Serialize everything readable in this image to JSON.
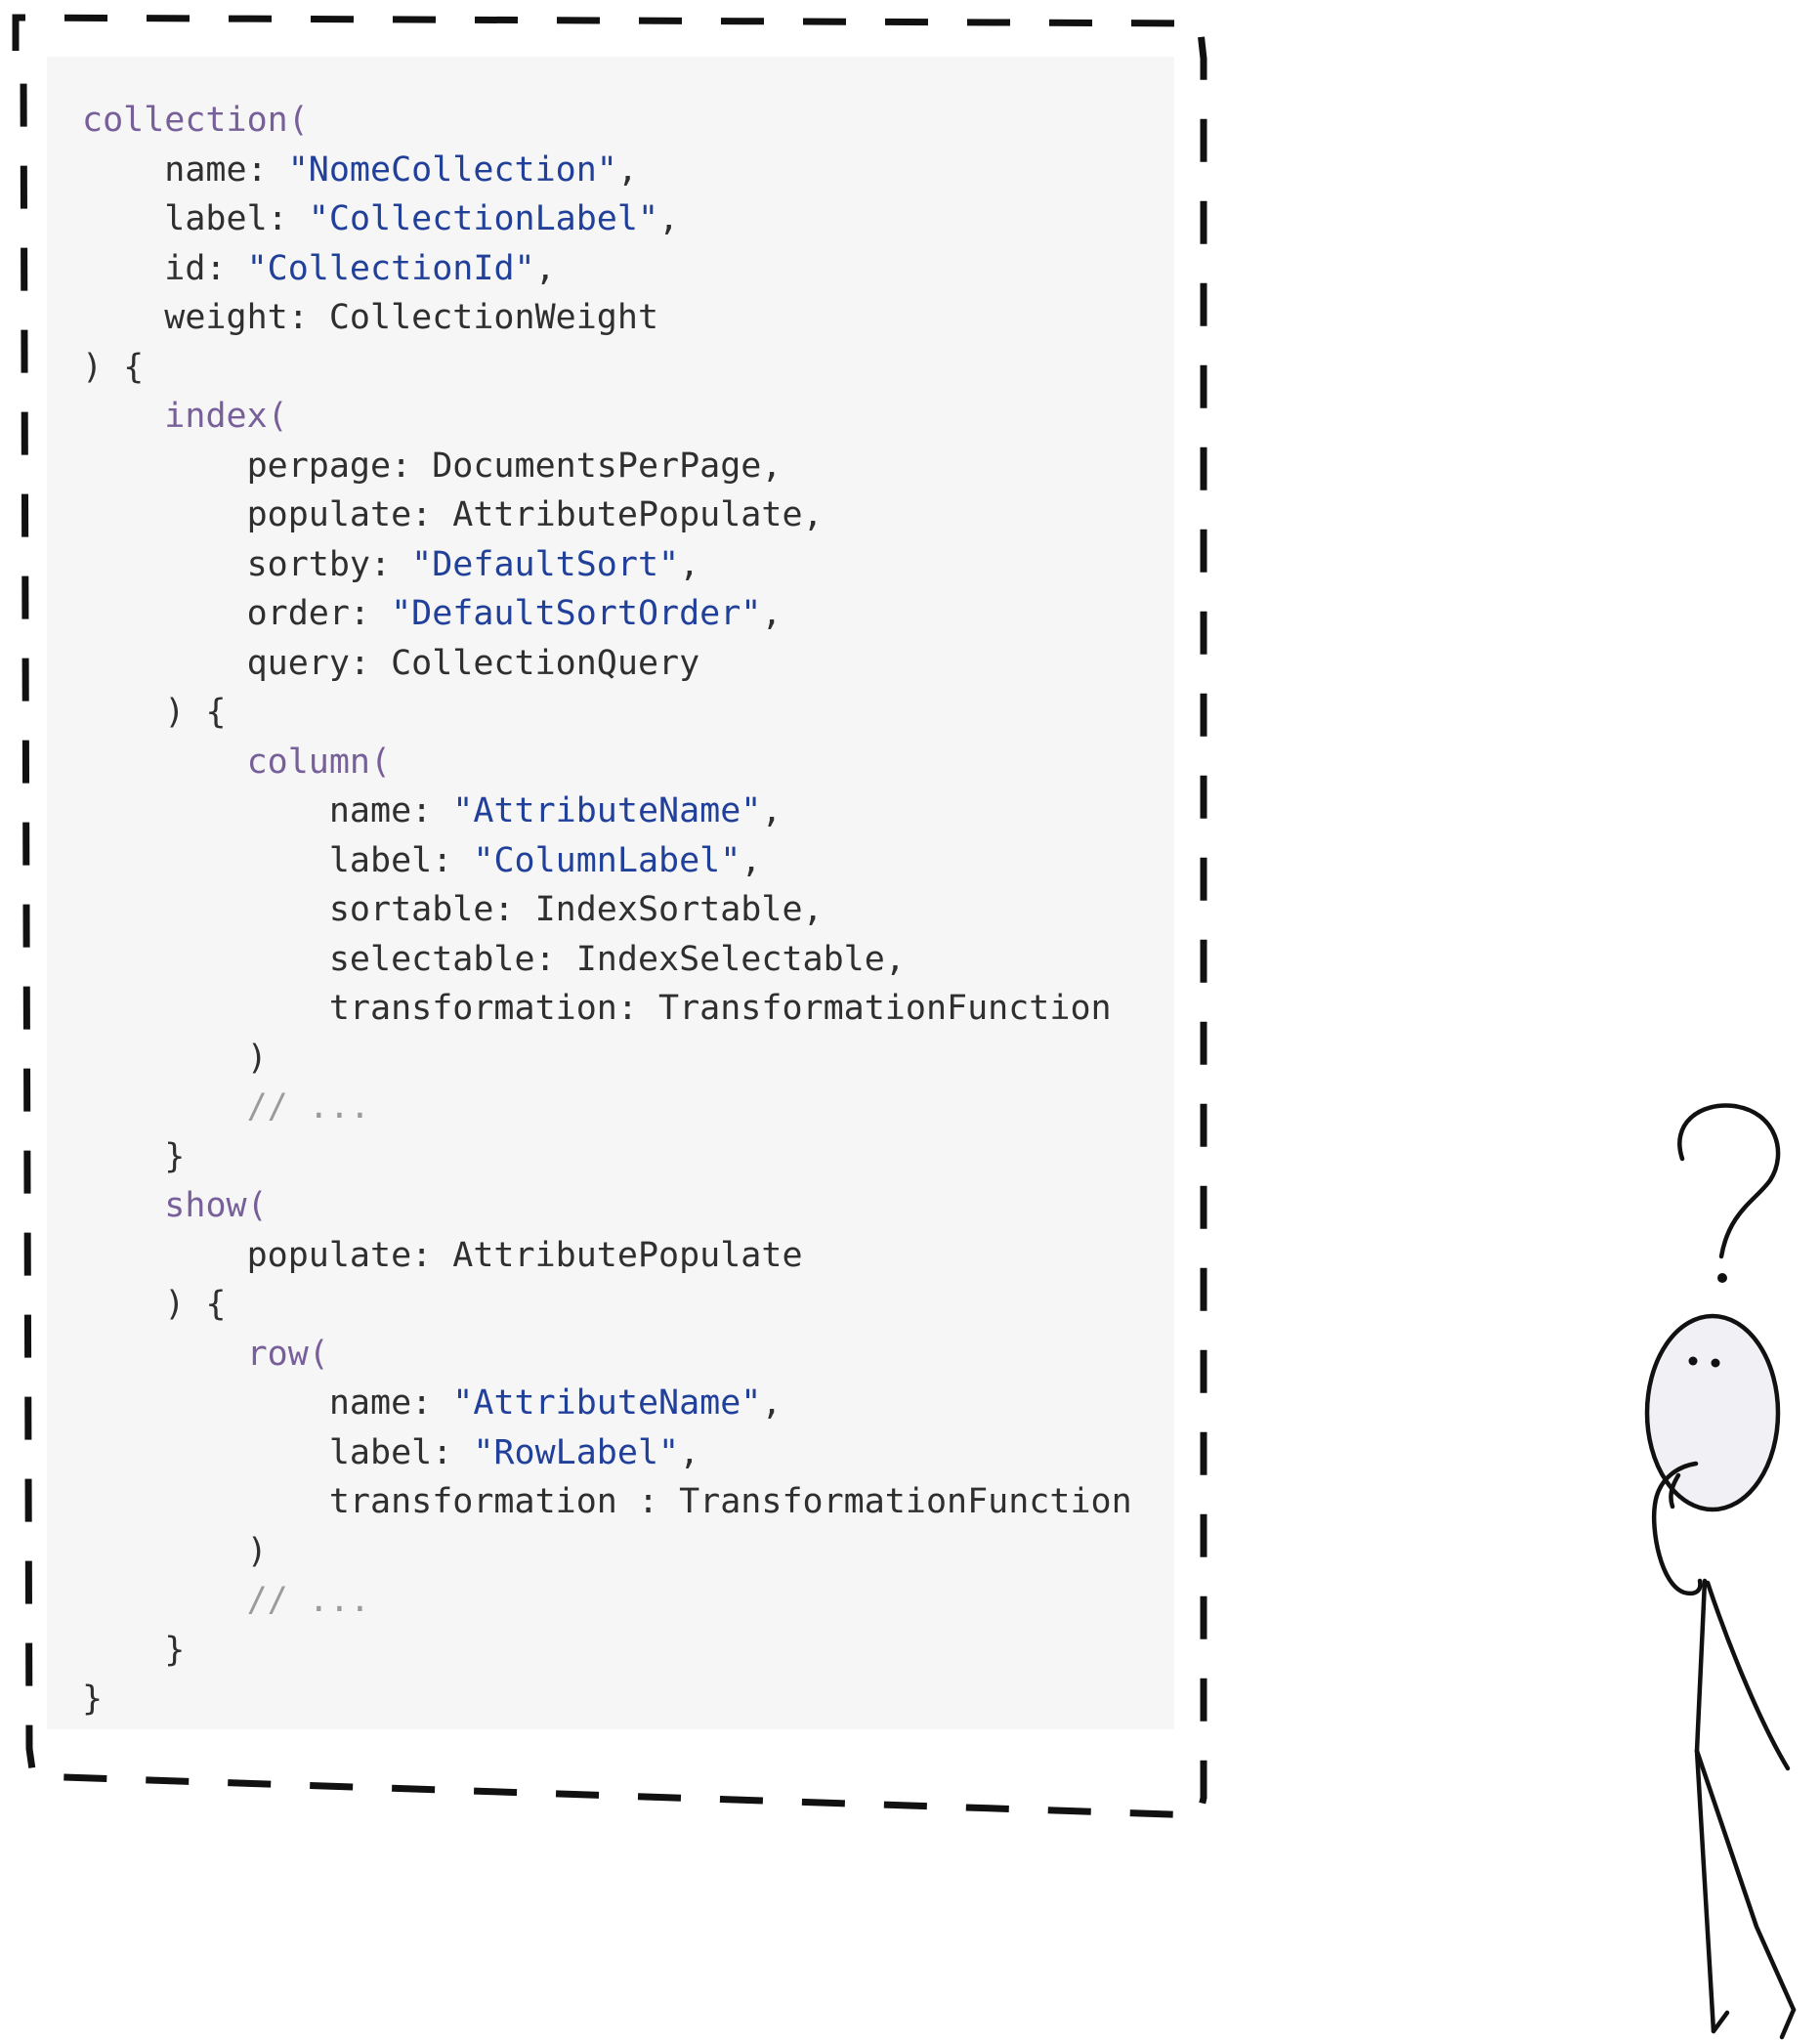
{
  "code_lines": [
    [
      {
        "t": "collection(",
        "c": "fn"
      }
    ],
    [
      {
        "t": "    name: ",
        "c": "pl"
      },
      {
        "t": "\"NomeCollection\"",
        "c": "str"
      },
      {
        "t": ",",
        "c": "pl"
      }
    ],
    [
      {
        "t": "    label: ",
        "c": "pl"
      },
      {
        "t": "\"CollectionLabel\"",
        "c": "str"
      },
      {
        "t": ",",
        "c": "pl"
      }
    ],
    [
      {
        "t": "    id: ",
        "c": "pl"
      },
      {
        "t": "\"CollectionId\"",
        "c": "str"
      },
      {
        "t": ",",
        "c": "pl"
      }
    ],
    [
      {
        "t": "    weight: CollectionWeight",
        "c": "pl"
      }
    ],
    [
      {
        "t": ") {",
        "c": "pl"
      }
    ],
    [
      {
        "t": "    ",
        "c": "pl"
      },
      {
        "t": "index(",
        "c": "fn"
      }
    ],
    [
      {
        "t": "        perpage: DocumentsPerPage,",
        "c": "pl"
      }
    ],
    [
      {
        "t": "        populate: AttributePopulate,",
        "c": "pl"
      }
    ],
    [
      {
        "t": "        sortby: ",
        "c": "pl"
      },
      {
        "t": "\"DefaultSort\"",
        "c": "str"
      },
      {
        "t": ",",
        "c": "pl"
      }
    ],
    [
      {
        "t": "        order: ",
        "c": "pl"
      },
      {
        "t": "\"DefaultSortOrder\"",
        "c": "str"
      },
      {
        "t": ",",
        "c": "pl"
      }
    ],
    [
      {
        "t": "        query: CollectionQuery",
        "c": "pl"
      }
    ],
    [
      {
        "t": "    ) {",
        "c": "pl"
      }
    ],
    [
      {
        "t": "        ",
        "c": "pl"
      },
      {
        "t": "column(",
        "c": "fn"
      }
    ],
    [
      {
        "t": "            name: ",
        "c": "pl"
      },
      {
        "t": "\"AttributeName\"",
        "c": "str"
      },
      {
        "t": ",",
        "c": "pl"
      }
    ],
    [
      {
        "t": "            label: ",
        "c": "pl"
      },
      {
        "t": "\"ColumnLabel\"",
        "c": "str"
      },
      {
        "t": ",",
        "c": "pl"
      }
    ],
    [
      {
        "t": "            sortable: IndexSortable,",
        "c": "pl"
      }
    ],
    [
      {
        "t": "            selectable: IndexSelectable,",
        "c": "pl"
      }
    ],
    [
      {
        "t": "            transformation: TransformationFunction",
        "c": "pl"
      }
    ],
    [
      {
        "t": "        )",
        "c": "pl"
      }
    ],
    [
      {
        "t": "        // ...",
        "c": "cm"
      }
    ],
    [
      {
        "t": "    }",
        "c": "pl"
      }
    ],
    [
      {
        "t": "    ",
        "c": "pl"
      },
      {
        "t": "show(",
        "c": "fn"
      }
    ],
    [
      {
        "t": "        populate: AttributePopulate",
        "c": "pl"
      }
    ],
    [
      {
        "t": "    ) {",
        "c": "pl"
      }
    ],
    [
      {
        "t": "        ",
        "c": "pl"
      },
      {
        "t": "row(",
        "c": "fn"
      }
    ],
    [
      {
        "t": "            name: ",
        "c": "pl"
      },
      {
        "t": "\"AttributeName\"",
        "c": "str"
      },
      {
        "t": ",",
        "c": "pl"
      }
    ],
    [
      {
        "t": "            label: ",
        "c": "pl"
      },
      {
        "t": "\"RowLabel\"",
        "c": "str"
      },
      {
        "t": ",",
        "c": "pl"
      }
    ],
    [
      {
        "t": "            transformation : TransformationFunction",
        "c": "pl"
      }
    ],
    [
      {
        "t": "        )",
        "c": "pl"
      }
    ],
    [
      {
        "t": "        // ...",
        "c": "cm"
      }
    ],
    [
      {
        "t": "    }",
        "c": "pl"
      }
    ],
    [
      {
        "t": "}",
        "c": "pl"
      }
    ]
  ],
  "colors": {
    "function": "#77609a",
    "string": "#21409a",
    "plain": "#2f2f2f",
    "comment": "#9b9b9b",
    "panel_background": "#f6f6f6",
    "border": "#111111"
  },
  "decorations": {
    "border_style": "dashed",
    "figure": "stick-figure-thinking",
    "figure_symbol": "question-mark"
  }
}
